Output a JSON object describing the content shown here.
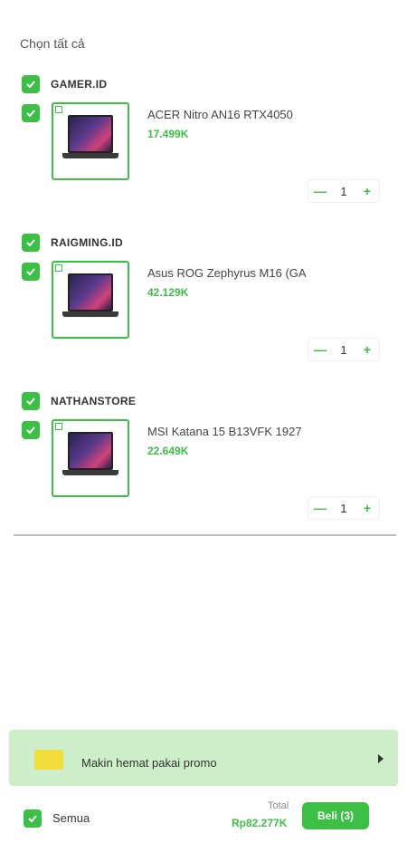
{
  "header": {
    "title": "Chọn tất cả"
  },
  "stores": [
    {
      "name": "GAMER.ID",
      "product": {
        "name": "ACER Nitro AN16 RTX4050",
        "price": "17.499K",
        "quantity": "1"
      }
    },
    {
      "name": "RAIGMING.ID",
      "product": {
        "name": "Asus ROG Zephyrus M16 (GA",
        "price": "42.129K",
        "quantity": "1"
      }
    },
    {
      "name": "NATHANSTORE",
      "product": {
        "name": "MSI Katana 15 B13VFK 1927",
        "price": "22.649K",
        "quantity": "1"
      }
    }
  ],
  "stepper": {
    "minus": "—",
    "plus": "+"
  },
  "promo": {
    "text": "Makin hemat pakai promo"
  },
  "footer": {
    "all_label": "Semua",
    "total_label": "Total",
    "total_value": "Rp82.277K",
    "buy_label": "Beli (3)"
  },
  "colors": {
    "accent": "#3cbf45",
    "promo_bg": "#cdeec8",
    "promo_tag": "#f2dc3c"
  }
}
